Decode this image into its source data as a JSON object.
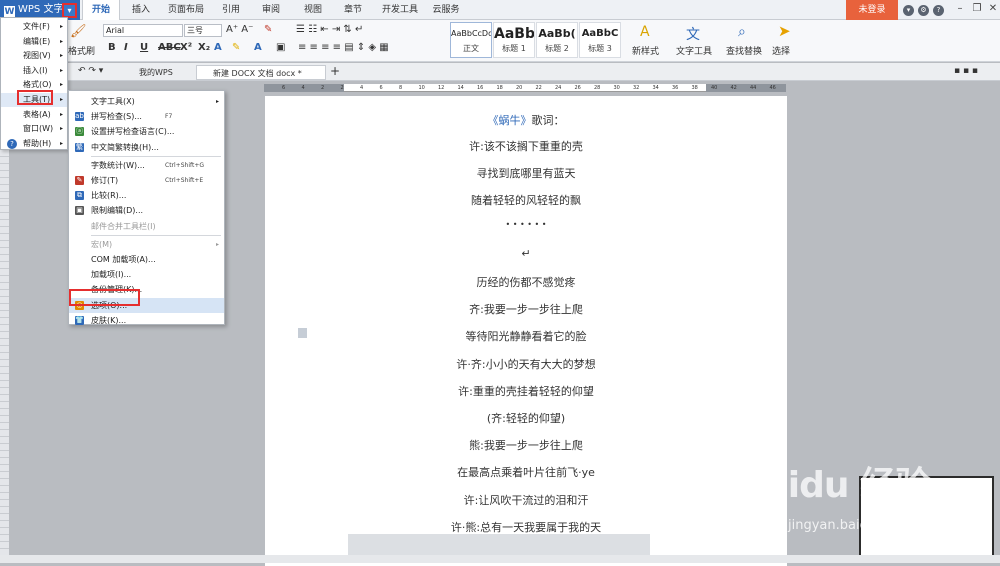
{
  "app": {
    "name": "WPS 文字",
    "tabs": [
      "开始",
      "插入",
      "页面布局",
      "引用",
      "审阅",
      "视图",
      "章节",
      "开发工具",
      "云服务"
    ],
    "login": "未登录"
  },
  "ribbon": {
    "format_painter": "格式刷",
    "font_name": "Arial",
    "font_size": "三号",
    "styles": [
      {
        "sample": "AaBbCcDd",
        "label": "正文"
      },
      {
        "sample": "AaBb",
        "label": "标题 1"
      },
      {
        "sample": "AaBb(",
        "label": "标题 2"
      },
      {
        "sample": "AaBbC",
        "label": "标题 3"
      }
    ],
    "new_style": "新样式",
    "text_tools": "文字工具",
    "find_replace": "查找替换",
    "select": "选择"
  },
  "doc_tabs": {
    "my_wps": "我的WPS",
    "new_doc": "新建 DOCX 文档 docx *"
  },
  "ruler": {
    "numbers": [
      "6",
      "4",
      "2",
      "2",
      "4",
      "6",
      "8",
      "10",
      "12",
      "14",
      "16",
      "18",
      "20",
      "22",
      "24",
      "26",
      "28",
      "30",
      "32",
      "34",
      "36",
      "38",
      "40",
      "42",
      "44",
      "46"
    ]
  },
  "menu_main": {
    "items": [
      {
        "label": "文件(F)",
        "arrow": "▸"
      },
      {
        "label": "编辑(E)",
        "arrow": "▸"
      },
      {
        "label": "视图(V)",
        "arrow": "▸"
      },
      {
        "label": "插入(I)",
        "arrow": "▸"
      },
      {
        "label": "格式(O)",
        "arrow": "▸"
      },
      {
        "label": "工具(T)",
        "arrow": "▸"
      },
      {
        "label": "表格(A)",
        "arrow": "▸"
      },
      {
        "label": "窗口(W)",
        "arrow": "▸"
      },
      {
        "label": "帮助(H)",
        "arrow": "▸"
      }
    ]
  },
  "menu_tools": {
    "items": [
      {
        "label": "文字工具(X)",
        "shortcut": "",
        "arrow": "▸",
        "disabled": false
      },
      {
        "label": "拼写检查(S)...",
        "shortcut": "F7",
        "arrow": "",
        "disabled": false
      },
      {
        "label": "设置拼写检查语言(C)...",
        "shortcut": "",
        "arrow": "",
        "disabled": false
      },
      {
        "label": "中文简繁转换(H)...",
        "shortcut": "",
        "arrow": "",
        "disabled": false
      },
      {
        "label": "字数统计(W)...",
        "shortcut": "Ctrl+Shift+G",
        "arrow": "",
        "disabled": false
      },
      {
        "label": "修订(T)",
        "shortcut": "Ctrl+Shift+E",
        "arrow": "",
        "disabled": false
      },
      {
        "label": "比较(R)...",
        "shortcut": "",
        "arrow": "",
        "disabled": false
      },
      {
        "label": "限制编辑(D)...",
        "shortcut": "",
        "arrow": "",
        "disabled": false
      },
      {
        "label": "邮件合并工具栏(I)",
        "shortcut": "",
        "arrow": "",
        "disabled": true
      },
      {
        "label": "宏(M)",
        "shortcut": "",
        "arrow": "▸",
        "disabled": true
      },
      {
        "label": "COM 加载项(A)...",
        "shortcut": "",
        "arrow": "",
        "disabled": false
      },
      {
        "label": "加载项(I)...",
        "shortcut": "",
        "arrow": "",
        "disabled": false
      },
      {
        "label": "备份管理(K)...",
        "shortcut": "",
        "arrow": "",
        "disabled": false
      },
      {
        "label": "选项(O)...",
        "shortcut": "",
        "arrow": "",
        "disabled": false
      },
      {
        "label": "皮肤(K)...",
        "shortcut": "",
        "arrow": "",
        "disabled": false
      }
    ]
  },
  "document": {
    "title_link": "《蜗牛》",
    "title_rest": "歌词：",
    "lines": [
      "许:该不该搁下重重的壳",
      "寻找到底哪里有蓝天",
      "随着轻轻的风轻轻的飘",
      "• • • • • •",
      "↵",
      "历经的伤都不感觉疼",
      "齐:我要一步一步往上爬",
      "等待阳光静静看着它的脸",
      "许·齐:小小的天有大大的梦想",
      "许:重重的壳挂着轻轻的仰望",
      "(齐:轻轻的仰望)",
      "熊:我要一步一步往上爬",
      "在最高点乘着叶片往前飞·ye",
      "许:让风吹干流过的泪和汗",
      "许·熊:总有一天我要属于我的天"
    ]
  },
  "watermark": {
    "brand": "Baidu 经验",
    "url": "jingyan.baidu.com"
  },
  "colors": {
    "accent": "#2f69b8",
    "highlight": "#e52e2e",
    "login": "#e8623c"
  }
}
